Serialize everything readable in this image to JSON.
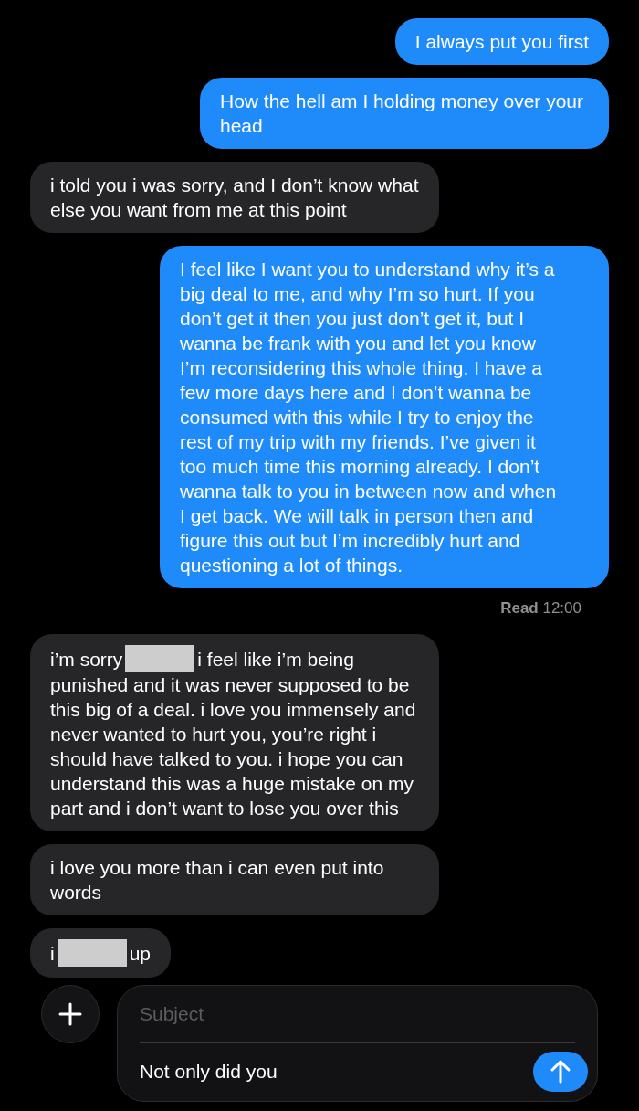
{
  "messages": [
    {
      "kind": "sent",
      "parts": [
        {
          "kind": "block",
          "text": "I always put you first"
        }
      ]
    },
    {
      "kind": "sent",
      "parts": [
        {
          "kind": "block",
          "text": "How the hell am I holding money over your head"
        }
      ]
    },
    {
      "kind": "received",
      "parts": [
        {
          "kind": "block",
          "text": "i told you i was sorry, and I don’t know what else you want from me at this point"
        }
      ]
    },
    {
      "kind": "sent",
      "parts": [
        {
          "kind": "block",
          "text": "I feel like I want you to understand why it’s a big deal to me, and why I’m so hurt. If you don’t get it then you just don’t get it, but I wanna be frank with you and let you know I’m reconsidering this whole thing. I have a few more days here and I don’t wanna be consumed with this while I try to enjoy the rest of my trip with my friends. I’ve given it too much time this morning already. I don’t wanna talk to you in between now and when I get back. We will talk in person then and figure this out but I’m incredibly hurt and questioning a lot of things."
        }
      ],
      "receipt": "**Read** 12:00"
    },
    {
      "kind": "received",
      "parts": [
        {
          "kind": "text",
          "text": "i’m sorry"
        },
        {
          "kind": "redaction"
        },
        {
          "kind": "text",
          "text": "i feel like i’m being"
        },
        {
          "kind": "block",
          "text": "punished and it was never supposed to be this big of a deal. i love you immensely and never wanted to hurt you, you’re right i should have talked to you. i hope you can understand this was a huge mistake on my part and i don’t want to lose you over this"
        }
      ]
    },
    {
      "kind": "received",
      "parts": [
        {
          "kind": "block",
          "text": "i love you more than i can even put into words"
        }
      ]
    },
    {
      "kind": "received",
      "parts": [
        {
          "kind": "text",
          "text": "i"
        },
        {
          "kind": "redaction"
        },
        {
          "kind": "text",
          "text": "up"
        }
      ]
    }
  ],
  "compose": {
    "subject_placeholder": "Subject",
    "message": "Not only did you"
  }
}
